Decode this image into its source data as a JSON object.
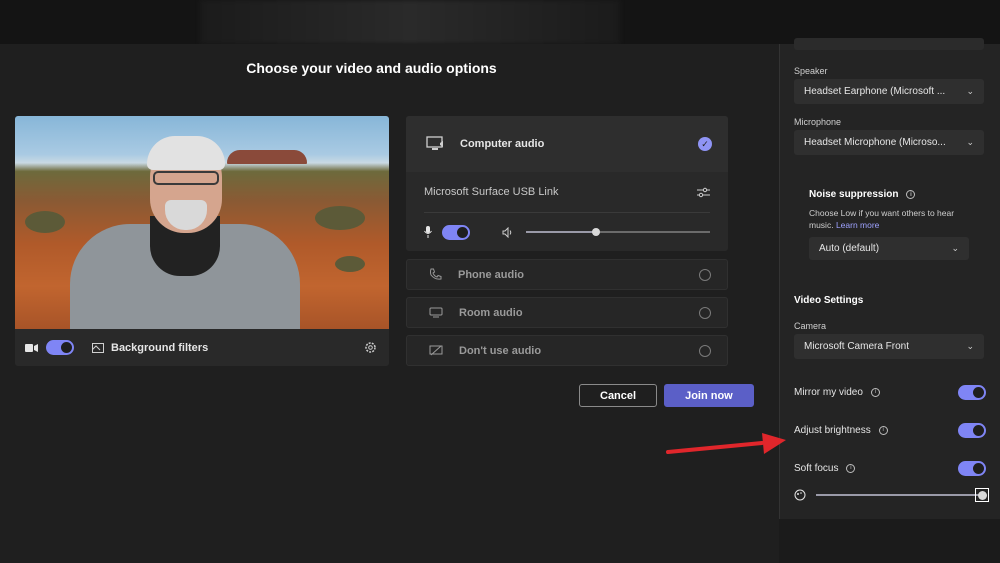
{
  "title": "Choose your video and audio options",
  "video": {
    "camera_toggle": "on",
    "background_filters_label": "Background filters"
  },
  "audio": {
    "computer_audio_label": "Computer audio",
    "device_name": "Microsoft Surface USB Link",
    "mic_toggle": "on",
    "volume_level": 0.38,
    "options": [
      {
        "label": "Phone audio"
      },
      {
        "label": "Room audio"
      },
      {
        "label": "Don't use audio"
      }
    ]
  },
  "actions": {
    "cancel_label": "Cancel",
    "join_label": "Join now"
  },
  "panel": {
    "speaker_label": "Speaker",
    "speaker_value": "Headset Earphone (Microsoft ...",
    "microphone_label": "Microphone",
    "microphone_value": "Headset Microphone (Microso...",
    "noise_title": "Noise suppression",
    "noise_desc": "Choose Low if you want others to hear music.",
    "noise_link": "Learn more",
    "noise_value": "Auto (default)",
    "video_settings_title": "Video Settings",
    "camera_label": "Camera",
    "camera_value": "Microsoft Camera Front",
    "mirror_label": "Mirror my video",
    "brightness_label": "Adjust brightness",
    "soft_focus_label": "Soft focus",
    "soft_focus_level": 1.0
  },
  "colors": {
    "accent": "#7f85f5",
    "join_button": "#5b5fc7",
    "annotation_arrow": "#e0262b"
  }
}
